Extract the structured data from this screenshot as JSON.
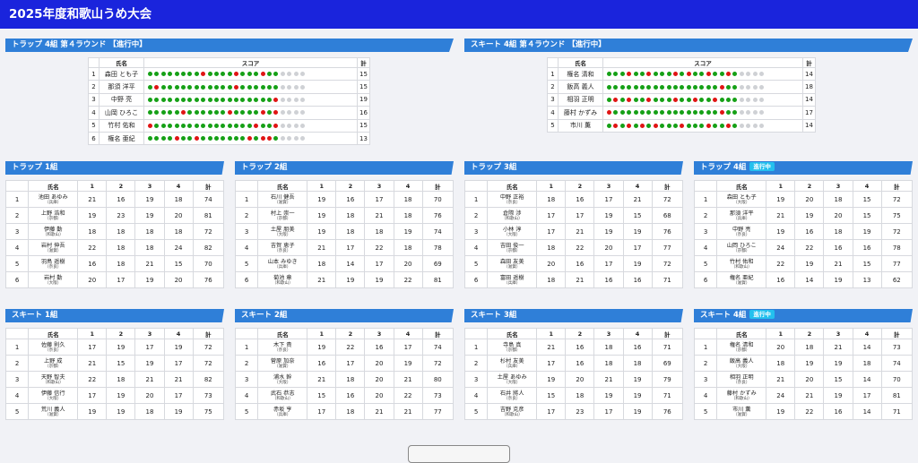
{
  "header": {
    "title": "2025年度和歌山うめ大会"
  },
  "current": [
    {
      "label": "トラップ 4組 第４ラウンド 【進行中】",
      "col_name": "氏名",
      "col_score": "スコア",
      "col_total": "計",
      "rows": [
        {
          "no": "1",
          "name": "森田 とも子",
          "shots": "GGGGGGGGRGGGGRGGGRGGNNNN",
          "total": "15"
        },
        {
          "no": "2",
          "name": "那須 洋平",
          "shots": "GRGGGGGGGGGGGRGGGGGGNNNN",
          "total": "15"
        },
        {
          "no": "3",
          "name": "中野 亮",
          "shots": "GGGGGGGGGGGGGGGGGGGRNNNN",
          "total": "19"
        },
        {
          "no": "4",
          "name": "山岡 ひろこ",
          "shots": "GGGGGRGGGGGGRGGGGRGRNNNN",
          "total": "16"
        },
        {
          "no": "5",
          "name": "竹村 佑和",
          "shots": "RGGGGGGGGGGGGGGGRGGRNNNN",
          "total": "15"
        },
        {
          "no": "6",
          "name": "権名 亜紀",
          "shots": "GGGGRGGRGGGGGGGRGRRGNNNN",
          "total": "13"
        }
      ]
    },
    {
      "label": "スキート 4組 第４ラウンド 【進行中】",
      "col_name": "氏名",
      "col_score": "スコア",
      "col_total": "計",
      "rows": [
        {
          "no": "1",
          "name": "権名 清和",
          "shots": "GGGRGGRGGGRGRGGRGGRGNNNN",
          "total": "14"
        },
        {
          "no": "2",
          "name": "飯高 義人",
          "shots": "GGGGGGGGGGGGGGGGGRGGNNNN",
          "total": "18"
        },
        {
          "no": "3",
          "name": "相羽 正明",
          "shots": "GRGRGGRGGGRGGRGGRGGGNNNN",
          "total": "14"
        },
        {
          "no": "4",
          "name": "藤村 かずみ",
          "shots": "RGGGGGGGGGGGGGGGGRGGNNNN",
          "total": "17"
        },
        {
          "no": "5",
          "name": "市川 薫",
          "shots": "GRGRGRGRGGGRGGGRGGRGNNNN",
          "total": "14"
        }
      ]
    }
  ],
  "groups": [
    {
      "label": "トラップ 1組",
      "badge": "",
      "cols": [
        "氏名",
        "1",
        "2",
        "3",
        "4",
        "計"
      ],
      "rows": [
        {
          "no": "1",
          "name": "池田 あゆみ",
          "pref": "（兵庫）",
          "s": [
            "21",
            "16",
            "19",
            "18",
            "74"
          ]
        },
        {
          "no": "2",
          "name": "上野 浩和",
          "pref": "（京都）",
          "s": [
            "19",
            "23",
            "19",
            "20",
            "81"
          ]
        },
        {
          "no": "3",
          "name": "伊藤 勤",
          "pref": "（和歌山）",
          "s": [
            "18",
            "18",
            "18",
            "18",
            "72"
          ]
        },
        {
          "no": "4",
          "name": "岩村 伸吾",
          "pref": "（滋賀）",
          "s": [
            "22",
            "18",
            "18",
            "24",
            "82"
          ]
        },
        {
          "no": "5",
          "name": "羽鳥 遥樹",
          "pref": "（奈良）",
          "s": [
            "16",
            "18",
            "21",
            "15",
            "70"
          ]
        },
        {
          "no": "6",
          "name": "岩村 勤",
          "pref": "（大阪）",
          "s": [
            "20",
            "17",
            "19",
            "20",
            "76"
          ]
        }
      ]
    },
    {
      "label": "トラップ 2組",
      "badge": "",
      "cols": [
        "氏名",
        "1",
        "2",
        "3",
        "4",
        "計"
      ],
      "rows": [
        {
          "no": "1",
          "name": "石川 健吾",
          "pref": "（滋賀）",
          "s": [
            "19",
            "16",
            "17",
            "18",
            "70"
          ]
        },
        {
          "no": "2",
          "name": "村上 崇一",
          "pref": "（京都）",
          "s": [
            "19",
            "18",
            "21",
            "18",
            "76"
          ]
        },
        {
          "no": "3",
          "name": "土屋 朋美",
          "pref": "（大阪）",
          "s": [
            "19",
            "18",
            "18",
            "19",
            "74"
          ]
        },
        {
          "no": "4",
          "name": "吉賀 恵子",
          "pref": "（奈良）",
          "s": [
            "21",
            "17",
            "22",
            "18",
            "78"
          ]
        },
        {
          "no": "5",
          "name": "山本 みゆき",
          "pref": "（兵庫）",
          "s": [
            "18",
            "14",
            "17",
            "20",
            "69"
          ]
        },
        {
          "no": "6",
          "name": "菊池 章",
          "pref": "（和歌山）",
          "s": [
            "21",
            "19",
            "19",
            "22",
            "81"
          ]
        }
      ]
    },
    {
      "label": "トラップ 3組",
      "badge": "",
      "cols": [
        "氏名",
        "1",
        "2",
        "3",
        "4",
        "計"
      ],
      "rows": [
        {
          "no": "1",
          "name": "中野 正裕",
          "pref": "（奈良）",
          "s": [
            "18",
            "16",
            "17",
            "21",
            "72"
          ]
        },
        {
          "no": "2",
          "name": "倉際 渉",
          "pref": "（和歌山）",
          "s": [
            "17",
            "17",
            "19",
            "15",
            "68"
          ]
        },
        {
          "no": "3",
          "name": "小林 淳",
          "pref": "（大阪）",
          "s": [
            "17",
            "21",
            "19",
            "19",
            "76"
          ]
        },
        {
          "no": "4",
          "name": "吉田 俊一",
          "pref": "（京都）",
          "s": [
            "18",
            "22",
            "20",
            "17",
            "77"
          ]
        },
        {
          "no": "5",
          "name": "森田 友美",
          "pref": "（滋賀）",
          "s": [
            "20",
            "16",
            "17",
            "19",
            "72"
          ]
        },
        {
          "no": "6",
          "name": "富田 遥樹",
          "pref": "（兵庫）",
          "s": [
            "18",
            "21",
            "16",
            "16",
            "71"
          ]
        }
      ]
    },
    {
      "label": "トラップ 4組",
      "badge": "進行中",
      "cols": [
        "氏名",
        "1",
        "2",
        "3",
        "4",
        "計"
      ],
      "rows": [
        {
          "no": "1",
          "name": "森田 とも子",
          "pref": "（大阪）",
          "s": [
            "19",
            "20",
            "18",
            "15",
            "72"
          ]
        },
        {
          "no": "2",
          "name": "那須 洋平",
          "pref": "（兵庫）",
          "s": [
            "21",
            "19",
            "20",
            "15",
            "75"
          ]
        },
        {
          "no": "3",
          "name": "中野 亮",
          "pref": "（奈良）",
          "s": [
            "19",
            "16",
            "18",
            "19",
            "72"
          ]
        },
        {
          "no": "4",
          "name": "山岡 ひろこ",
          "pref": "（京都）",
          "s": [
            "24",
            "22",
            "16",
            "16",
            "78"
          ]
        },
        {
          "no": "5",
          "name": "竹村 佑和",
          "pref": "（和歌山）",
          "s": [
            "22",
            "19",
            "21",
            "15",
            "77"
          ]
        },
        {
          "no": "6",
          "name": "権名 亜紀",
          "pref": "（滋賀）",
          "s": [
            "16",
            "14",
            "19",
            "13",
            "62"
          ]
        }
      ]
    },
    {
      "label": "スキート 1組",
      "badge": "",
      "cols": [
        "氏名",
        "1",
        "2",
        "3",
        "4",
        "計"
      ],
      "rows": [
        {
          "no": "1",
          "name": "佐藤 則久",
          "pref": "（奈良）",
          "s": [
            "17",
            "19",
            "17",
            "19",
            "72"
          ]
        },
        {
          "no": "2",
          "name": "上野 成",
          "pref": "（京都）",
          "s": [
            "21",
            "15",
            "19",
            "17",
            "72"
          ]
        },
        {
          "no": "3",
          "name": "天野 智夫",
          "pref": "（和歌山）",
          "s": [
            "22",
            "18",
            "21",
            "21",
            "82"
          ]
        },
        {
          "no": "4",
          "name": "伊藤 信行",
          "pref": "（大阪）",
          "s": [
            "17",
            "19",
            "20",
            "17",
            "73"
          ]
        },
        {
          "no": "5",
          "name": "荒川 義人",
          "pref": "（滋賀）",
          "s": [
            "19",
            "19",
            "18",
            "19",
            "75"
          ]
        }
      ]
    },
    {
      "label": "スキート 2組",
      "badge": "",
      "cols": [
        "氏名",
        "1",
        "2",
        "3",
        "4",
        "計"
      ],
      "rows": [
        {
          "no": "1",
          "name": "木下 貴",
          "pref": "（奈良）",
          "s": [
            "19",
            "22",
            "16",
            "17",
            "74"
          ]
        },
        {
          "no": "2",
          "name": "菅原 加奈",
          "pref": "（滋賀）",
          "s": [
            "16",
            "17",
            "20",
            "19",
            "72"
          ]
        },
        {
          "no": "3",
          "name": "浦水 幹",
          "pref": "（大阪）",
          "s": [
            "21",
            "18",
            "20",
            "21",
            "80"
          ]
        },
        {
          "no": "4",
          "name": "武石 恭志",
          "pref": "（和歌山）",
          "s": [
            "15",
            "16",
            "20",
            "22",
            "73"
          ]
        },
        {
          "no": "5",
          "name": "赤坂 亨",
          "pref": "（兵庫）",
          "s": [
            "17",
            "18",
            "21",
            "21",
            "77"
          ]
        }
      ]
    },
    {
      "label": "スキート 3組",
      "badge": "",
      "cols": [
        "氏名",
        "1",
        "2",
        "3",
        "4",
        "計"
      ],
      "rows": [
        {
          "no": "1",
          "name": "寺島 真",
          "pref": "（京都）",
          "s": [
            "21",
            "16",
            "18",
            "16",
            "71"
          ]
        },
        {
          "no": "2",
          "name": "杉村 友美",
          "pref": "（兵庫）",
          "s": [
            "17",
            "16",
            "18",
            "18",
            "69"
          ]
        },
        {
          "no": "3",
          "name": "土屋 あゆみ",
          "pref": "（大阪）",
          "s": [
            "19",
            "20",
            "21",
            "19",
            "79"
          ]
        },
        {
          "no": "4",
          "name": "石井 將人",
          "pref": "（奈良）",
          "s": [
            "15",
            "18",
            "19",
            "19",
            "71"
          ]
        },
        {
          "no": "5",
          "name": "吉野 克彦",
          "pref": "（和歌山）",
          "s": [
            "17",
            "23",
            "17",
            "19",
            "76"
          ]
        }
      ]
    },
    {
      "label": "スキート 4組",
      "badge": "進行中",
      "cols": [
        "氏名",
        "1",
        "2",
        "3",
        "4",
        "計"
      ],
      "rows": [
        {
          "no": "1",
          "name": "権名 清和",
          "pref": "（京都）",
          "s": [
            "20",
            "18",
            "21",
            "14",
            "73"
          ]
        },
        {
          "no": "2",
          "name": "飯高 義人",
          "pref": "（大阪）",
          "s": [
            "18",
            "19",
            "19",
            "18",
            "74"
          ]
        },
        {
          "no": "3",
          "name": "相羽 正明",
          "pref": "（奈良）",
          "s": [
            "21",
            "20",
            "15",
            "14",
            "70"
          ]
        },
        {
          "no": "4",
          "name": "藤村 かずみ",
          "pref": "（和歌山）",
          "s": [
            "24",
            "21",
            "19",
            "17",
            "81"
          ]
        },
        {
          "no": "5",
          "name": "市川 薫",
          "pref": "（滋賀）",
          "s": [
            "19",
            "22",
            "16",
            "14",
            "71"
          ]
        }
      ]
    }
  ]
}
